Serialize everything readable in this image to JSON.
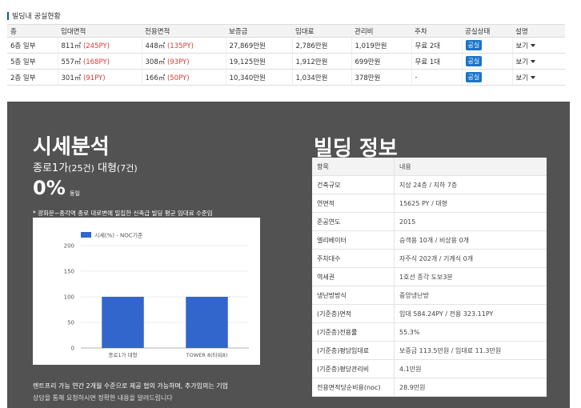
{
  "vacancy": {
    "title": "빌딩내 공실현황",
    "headers": [
      "층",
      "임대면적",
      "전용면적",
      "보증금",
      "임대료",
      "관리비",
      "주차",
      "공실상태",
      "설명"
    ],
    "rows": [
      {
        "floor": "6층 일부",
        "rent_area": "811㎡",
        "rent_py": "(245PY)",
        "net_area": "448㎡",
        "net_py": "(135PY)",
        "deposit": "27,869만원",
        "rent": "2,786만원",
        "fee": "1,019만원",
        "parking": "무료 2대",
        "status": "공실",
        "desc": "보기"
      },
      {
        "floor": "5층 일부",
        "rent_area": "557㎡",
        "rent_py": "(168PY)",
        "net_area": "308㎡",
        "net_py": "(93PY)",
        "deposit": "19,125만원",
        "rent": "1,912만원",
        "fee": "699만원",
        "parking": "무료 1대",
        "status": "공실",
        "desc": "보기"
      },
      {
        "floor": "2층 일부",
        "rent_area": "301㎡",
        "rent_py": "(91PY)",
        "net_area": "166㎡",
        "net_py": "(50PY)",
        "deposit": "10,340만원",
        "rent": "1,034만원",
        "fee": "378만원",
        "parking": "-",
        "status": "공실",
        "desc": "보기"
      }
    ]
  },
  "market": {
    "title": "시세분석",
    "subtitle_main": "종로1가",
    "subtitle_count1": "(25건)",
    "subtitle_size": " 대형",
    "subtitle_count2": "(7건)",
    "percent": "0%",
    "percent_label": "동일",
    "note": "* 광화문~종각역 종로 대로변에 밀집한 신축급 빌딩 평균 임대료 수준임",
    "footer_line1": "렌트프리 가능 연간 2개월 수준으로 제공 협의 가능하며, 추가입의는 기업",
    "footer_line2": "상담을 통해 요청하시면 정확한 내용을 알려드립니다"
  },
  "chart_data": {
    "type": "bar",
    "categories": [
      "종로1가 대형",
      "TOWER 8(타워8)"
    ],
    "series": [
      {
        "name": "시세(%) - NOC기준",
        "values": [
          100,
          100
        ]
      }
    ],
    "ylim": [
      0,
      200
    ],
    "yticks": [
      0,
      50,
      100,
      150,
      200
    ],
    "legend": "top-left",
    "colors": {
      "bar": "#3366cc"
    }
  },
  "building": {
    "title": "빌딩 정보",
    "header": {
      "k": "항목",
      "v": "내용"
    },
    "rows": [
      {
        "k": "건축규모",
        "v": "지상 24층 / 지하 7층"
      },
      {
        "k": "연면적",
        "v": "15625 PY / 대형"
      },
      {
        "k": "준공연도",
        "v": "2015"
      },
      {
        "k": "엘리베이터",
        "v": "승객용 10개 / 비상용 0개"
      },
      {
        "k": "주차대수",
        "v": "자주식 202개 / 기계식 0개"
      },
      {
        "k": "역세권",
        "v": "1호선 종각 도보3분"
      },
      {
        "k": "냉난방방식",
        "v": "중앙냉난방"
      },
      {
        "k": "(기준층)면적",
        "v": "임대 584.24PY / 전용 323.11PY"
      },
      {
        "k": "(기준층)전용률",
        "v": "55.3%"
      },
      {
        "k": "(기준층)평당임대료",
        "v": "보증금 113.5만원 / 임대료 11.3만원"
      },
      {
        "k": "(기준층)평당관리비",
        "v": "4.1만원"
      },
      {
        "k": "전용면적당순비용(noc)",
        "v": "28.9만원"
      }
    ]
  }
}
